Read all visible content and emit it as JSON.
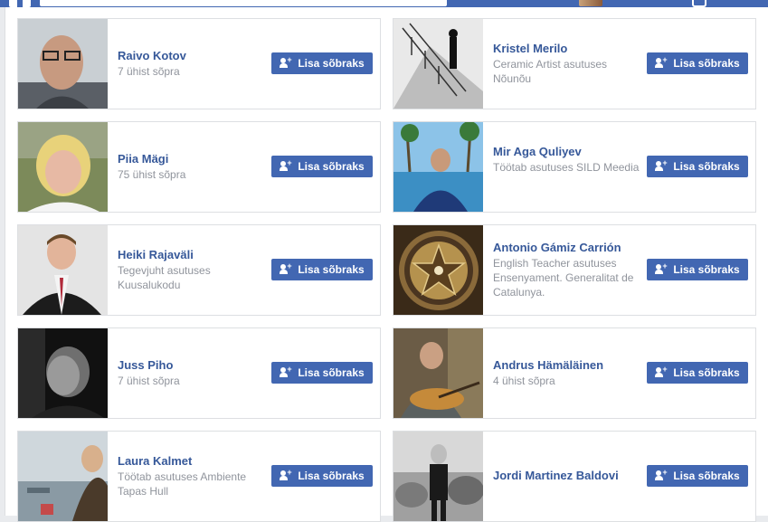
{
  "colors": {
    "brand": "#4267b2",
    "link": "#365899",
    "muted": "#90949c"
  },
  "button_label": "Lisa sõbraks",
  "people": [
    {
      "name": "Raivo Kotov",
      "sub": "7 ühist sõpra",
      "icon": "person-glasses-photo"
    },
    {
      "name": "Kristel Merilo",
      "sub": "Ceramic Artist asutuses Nõunõu",
      "icon": "stairs-photo"
    },
    {
      "name": "Piia Mägi",
      "sub": "75 ühist sõpra",
      "icon": "blonde-woman-photo"
    },
    {
      "name": "Mir Aga Quliyev",
      "sub": "Töötab asutuses SILD Meedia",
      "icon": "pool-palms-photo"
    },
    {
      "name": "Heiki Rajaväli",
      "sub": "Tegevjuht asutuses Kuusalukodu",
      "icon": "man-suit-photo"
    },
    {
      "name": "Antonio Gámiz Carrión",
      "sub": "English Teacher asutuses Ensenyament. Generalitat de Catalunya.",
      "icon": "ornament-star-photo"
    },
    {
      "name": "Juss Piho",
      "sub": "7 ühist sõpra",
      "icon": "dark-portrait-photo"
    },
    {
      "name": "Andrus Hämäläinen",
      "sub": "4 ühist sõpra",
      "icon": "guitar-man-photo"
    },
    {
      "name": "Laura Kalmet",
      "sub": "Töötab asutuses Ambiente Tapas Hull",
      "icon": "beach-woman-photo"
    },
    {
      "name": "Jordi Martinez Baldovi",
      "sub": "",
      "icon": "man-rocks-photo"
    }
  ]
}
